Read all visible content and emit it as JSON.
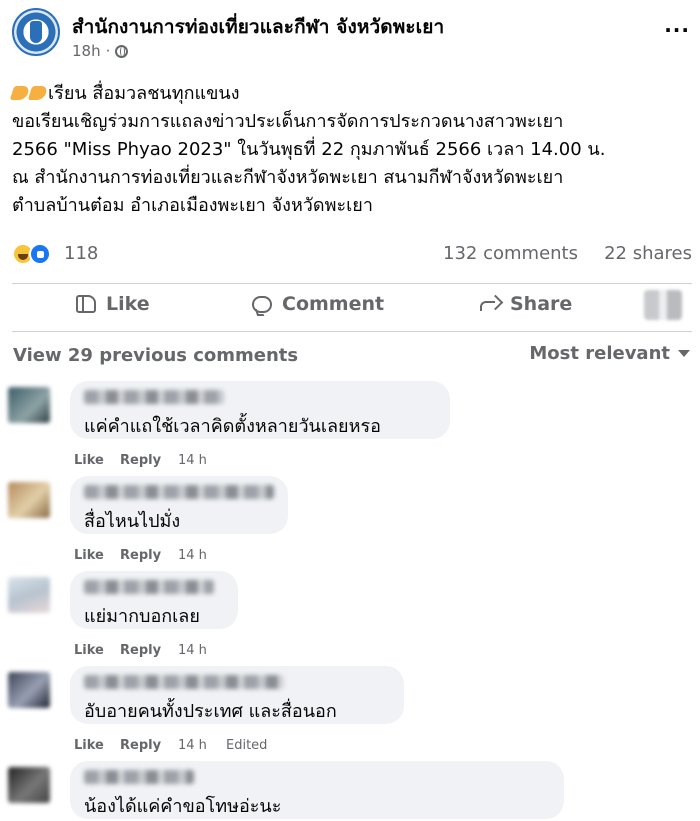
{
  "post": {
    "page_name": "สำนักงานการท่องเที่ยวและกีฬา จังหวัดพะเยา",
    "time": "18h",
    "dot": "·",
    "more": "···",
    "text_lines": [
      "เรียน สื่อมวลชนทุกแขนง",
      " ขอเรียนเชิญร่วมการแถลงข่าวประเด็นการจัดการประกวดนางสาวพะเยา",
      "2566 \"Miss Phyao 2023\" ในวันพุธที่ 22 กุมภาพันธ์ 2566 เวลา 14.00 น.",
      "ณ สำนักงานการท่องเที่ยวและกีฬาจังหวัดพะเยา สนามกีฬาจังหวัดพะเยา",
      "ตำบลบ้านต๋อม อำเภอเมืองพะเยา จังหวัดพะเยา"
    ],
    "reactions_count": "118",
    "comments_count": "132 comments",
    "shares_count": "22 shares"
  },
  "actions": {
    "like": "Like",
    "comment": "Comment",
    "share": "Share"
  },
  "comments_header": {
    "view_previous": "View 29 previous comments",
    "sort": "Most relevant"
  },
  "comments": [
    {
      "text": "แค่คำแถใช้เวลาคิดตั้งหลายวันเลยหรอ",
      "like": "Like",
      "reply": "Reply",
      "time": "14 h",
      "edited": ""
    },
    {
      "text": "สื่อไหนไปมั่ง",
      "like": "Like",
      "reply": "Reply",
      "time": "14 h",
      "edited": ""
    },
    {
      "text": "แย่มากบอกเลย",
      "like": "Like",
      "reply": "Reply",
      "time": "14 h",
      "edited": ""
    },
    {
      "text": "อับอายคนทั้งประเทศ และสื่อนอก",
      "like": "Like",
      "reply": "Reply",
      "time": "14 h",
      "edited": "Edited"
    },
    {
      "text": "น้องได้แค่คำขอโทษอ่ะนะ",
      "like": "",
      "reply": "",
      "time": "",
      "edited": ""
    }
  ],
  "colors": {
    "text": "#050505",
    "secondary": "#65676b",
    "bubble": "#f0f2f5",
    "like_blue": "#1877f2"
  }
}
